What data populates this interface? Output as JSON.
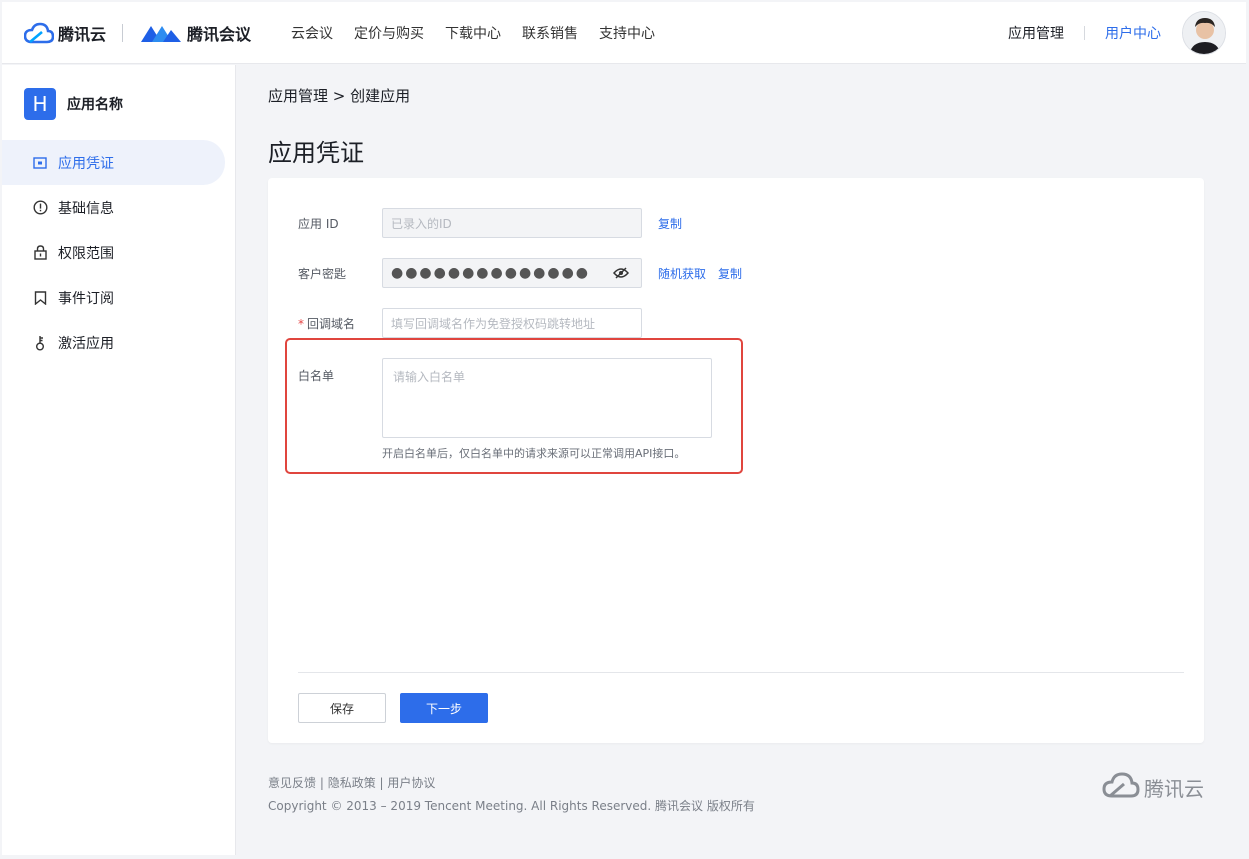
{
  "header": {
    "brand_tencent_cloud": "腾讯云",
    "brand_meeting": "腾讯会议",
    "nav": [
      "云会议",
      "定价与购买",
      "下载中心",
      "联系销售",
      "支持中心"
    ],
    "app_manage": "应用管理",
    "user_center": "用户中心"
  },
  "sidebar": {
    "app_badge": "H",
    "app_name": "应用名称",
    "items": [
      {
        "label": "应用凭证",
        "icon": "credential-icon",
        "active": true
      },
      {
        "label": "基础信息",
        "icon": "info-circle-icon",
        "active": false
      },
      {
        "label": "权限范围",
        "icon": "lock-icon",
        "active": false
      },
      {
        "label": "事件订阅",
        "icon": "bookmark-icon",
        "active": false
      },
      {
        "label": "激活应用",
        "icon": "key-icon",
        "active": false
      }
    ]
  },
  "breadcrumb": "应用管理 > 创建应用",
  "page_title": "应用凭证",
  "form": {
    "app_id": {
      "label": "应用 ID",
      "placeholder": "已录入的ID",
      "copy": "复制"
    },
    "secret": {
      "label": "客户密匙",
      "value": "●●●●●●●●●●●●●●",
      "random": "随机获取",
      "copy": "复制"
    },
    "redirect": {
      "required_mark": "*",
      "label": "回调域名",
      "placeholder": "填写回调域名作为免登授权码跳转地址"
    },
    "whitelist": {
      "label": "白名单",
      "placeholder": "请输入白名单",
      "hint": "开启白名单后，仅白名单中的请求来源可以正常调用API接口。"
    }
  },
  "buttons": {
    "save": "保存",
    "next": "下一步"
  },
  "footer": {
    "links": [
      "意见反馈",
      "隐私政策",
      "用户协议"
    ],
    "separator": " | ",
    "copyright": "Copyright © 2013 – 2019 Tencent Meeting. All Rights Reserved.  腾讯会议 版权所有",
    "logo_text": "腾讯云"
  },
  "colors": {
    "accent": "#2d6dea",
    "highlight": "#e0453e",
    "required": "#e54545"
  }
}
